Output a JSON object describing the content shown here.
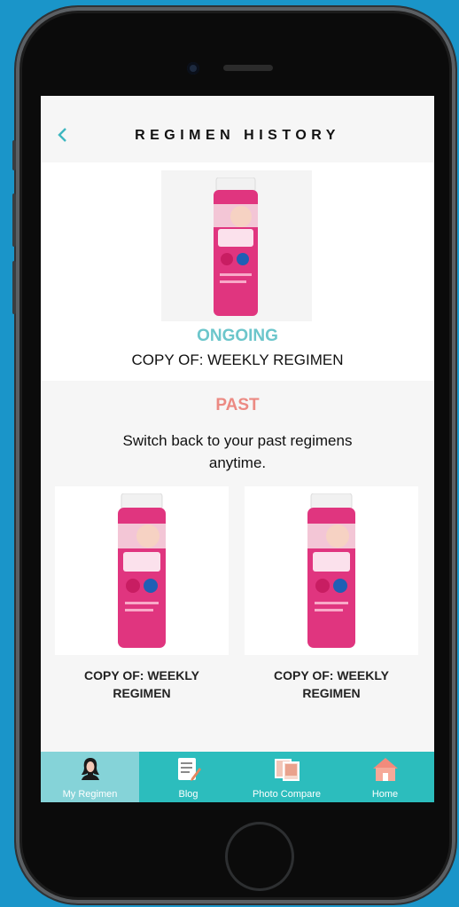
{
  "header": {
    "title": "REGIMEN HISTORY",
    "back_icon": "chevron-left-icon"
  },
  "ongoing": {
    "status": "ONGOING",
    "name": "COPY OF: WEEKLY REGIMEN"
  },
  "past": {
    "heading": "PAST",
    "description": "Switch back to your past regimens anytime.",
    "items": [
      {
        "name": "COPY OF: WEEKLY REGIMEN"
      },
      {
        "name": "COPY OF: WEEKLY REGIMEN"
      }
    ]
  },
  "tabbar": {
    "items": [
      {
        "label": "My Regimen",
        "icon": "person-icon",
        "active": true
      },
      {
        "label": "Blog",
        "icon": "document-icon",
        "active": false
      },
      {
        "label": "Photo Compare",
        "icon": "photos-icon",
        "active": false
      },
      {
        "label": "Home",
        "icon": "house-icon",
        "active": false
      }
    ]
  },
  "colors": {
    "accent": "#2cbdbd",
    "ongoing": "#6cc6cb",
    "past": "#ec8a83",
    "bottle": "#e0357f"
  }
}
